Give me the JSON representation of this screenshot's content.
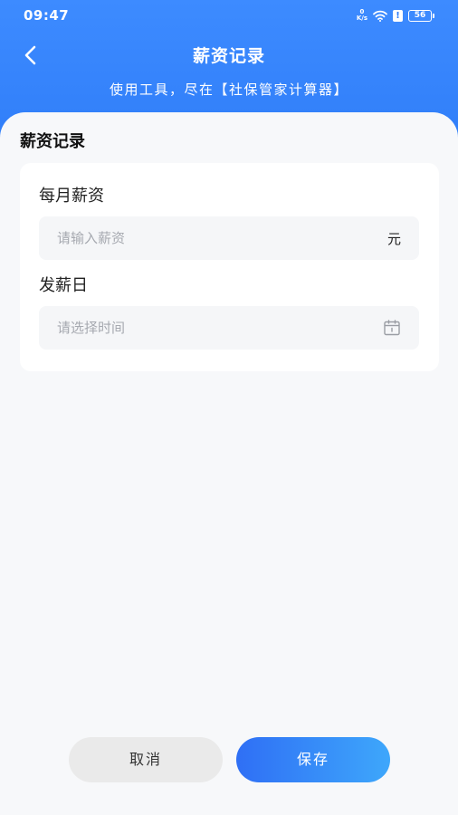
{
  "status_bar": {
    "time": "09:47",
    "net_speed_value": "0",
    "net_speed_unit": "K/s",
    "warn_symbol": "!",
    "battery": "56"
  },
  "header": {
    "title": "薪资记录",
    "subtitle": "使用工具，尽在【社保管家计算器】"
  },
  "section": {
    "title": "薪资记录"
  },
  "form": {
    "salary": {
      "label": "每月薪资",
      "placeholder": "请输入薪资",
      "unit": "元"
    },
    "payday": {
      "label": "发薪日",
      "placeholder": "请选择时间"
    }
  },
  "actions": {
    "cancel_label": "取消",
    "save_label": "保存"
  },
  "colors": {
    "header_blue": "#2f7df8",
    "save_gradient_start": "#2f6ff5",
    "save_gradient_end": "#3ea7fb",
    "cancel_bg": "#eaeaea"
  }
}
